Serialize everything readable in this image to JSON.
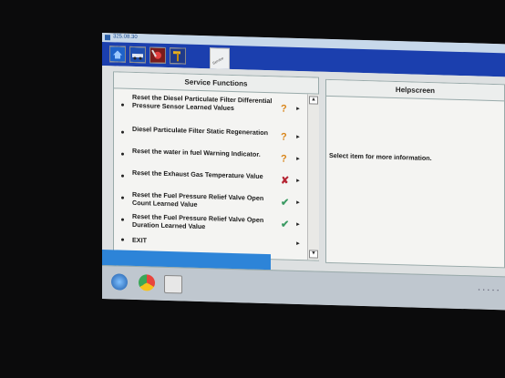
{
  "window": {
    "title": "325.08.30"
  },
  "toolbar": {
    "buttons": [
      {
        "name": "home-icon"
      },
      {
        "name": "vehicle-icon"
      },
      {
        "name": "tools-icon"
      },
      {
        "name": "hammer-icon"
      }
    ],
    "active_tab_label": "Service"
  },
  "service_functions": {
    "header": "Service Functions",
    "items": [
      {
        "label": "Reset the Diesel Particulate Filter Differential Pressure Sensor Learned Values",
        "status": "?",
        "status_type": "unknown"
      },
      {
        "label": "Diesel Particulate Filter Static Regeneration",
        "status": "?",
        "status_type": "unknown"
      },
      {
        "label": "Reset the water in fuel Warning Indicator.",
        "status": "?",
        "status_type": "unknown"
      },
      {
        "label": "Reset the Exhaust Gas Temperature Value",
        "status": "✘",
        "status_type": "failed"
      },
      {
        "label": "Reset the Fuel Pressure Relief Valve Open Count Learned Value",
        "status": "✔",
        "status_type": "passed"
      },
      {
        "label": "Reset the Fuel Pressure Relief Valve Open Duration Learned Value",
        "status": "✔",
        "status_type": "passed"
      },
      {
        "label": "EXIT",
        "status": "",
        "status_type": "none"
      }
    ],
    "arrow": "►"
  },
  "helpscreen": {
    "header": "Helpscreen",
    "text": "Select item for more information."
  },
  "scrollbar": {
    "up": "▲",
    "down": "▼"
  },
  "colors": {
    "toolbar": "#1b3fae",
    "status_unknown": "#d9871d",
    "status_failed": "#b52634",
    "status_passed": "#3a9a62"
  }
}
